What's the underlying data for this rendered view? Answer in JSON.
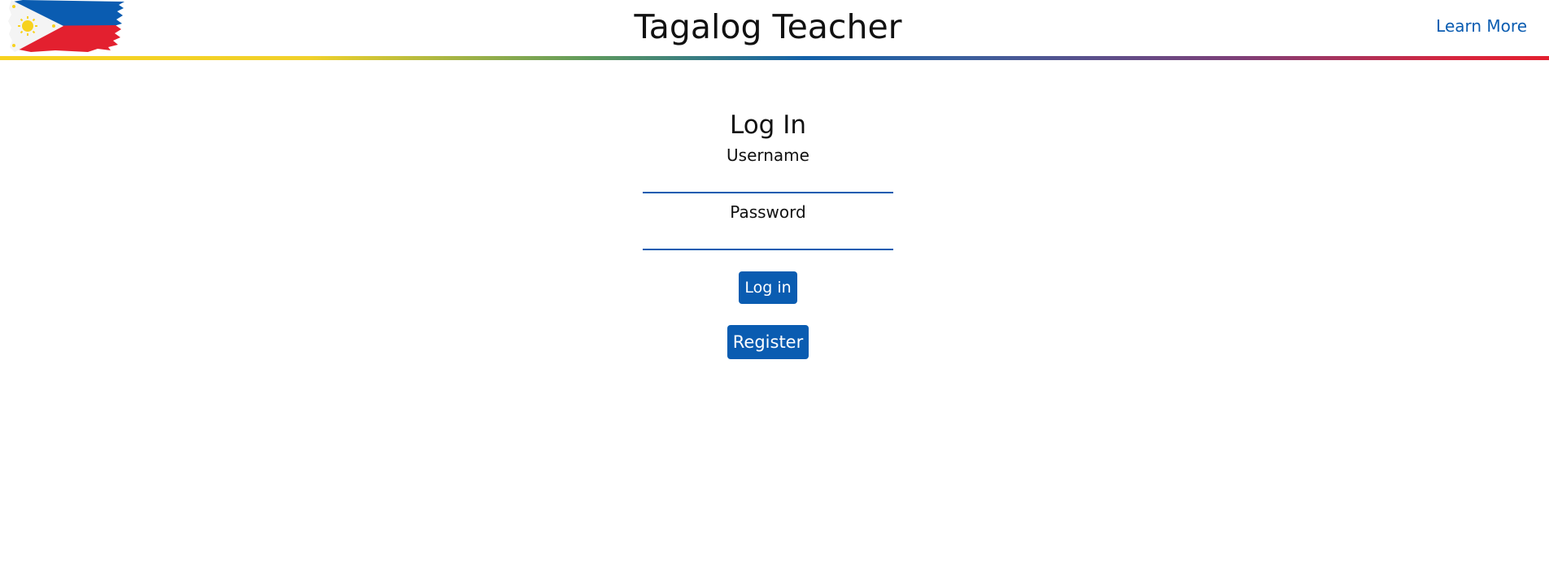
{
  "header": {
    "title": "Tagalog Teacher",
    "learn_more": "Learn More",
    "logo_icon": "philippine-flag-icon"
  },
  "login": {
    "heading": "Log In",
    "username_label": "Username",
    "username_value": "",
    "password_label": "Password",
    "password_value": "",
    "login_button": "Log in",
    "register_button": "Register"
  },
  "colors": {
    "accent": "#0a5cb1",
    "flag_blue": "#0a5cb1",
    "flag_red": "#e3202f",
    "flag_yellow": "#f7d21f"
  }
}
